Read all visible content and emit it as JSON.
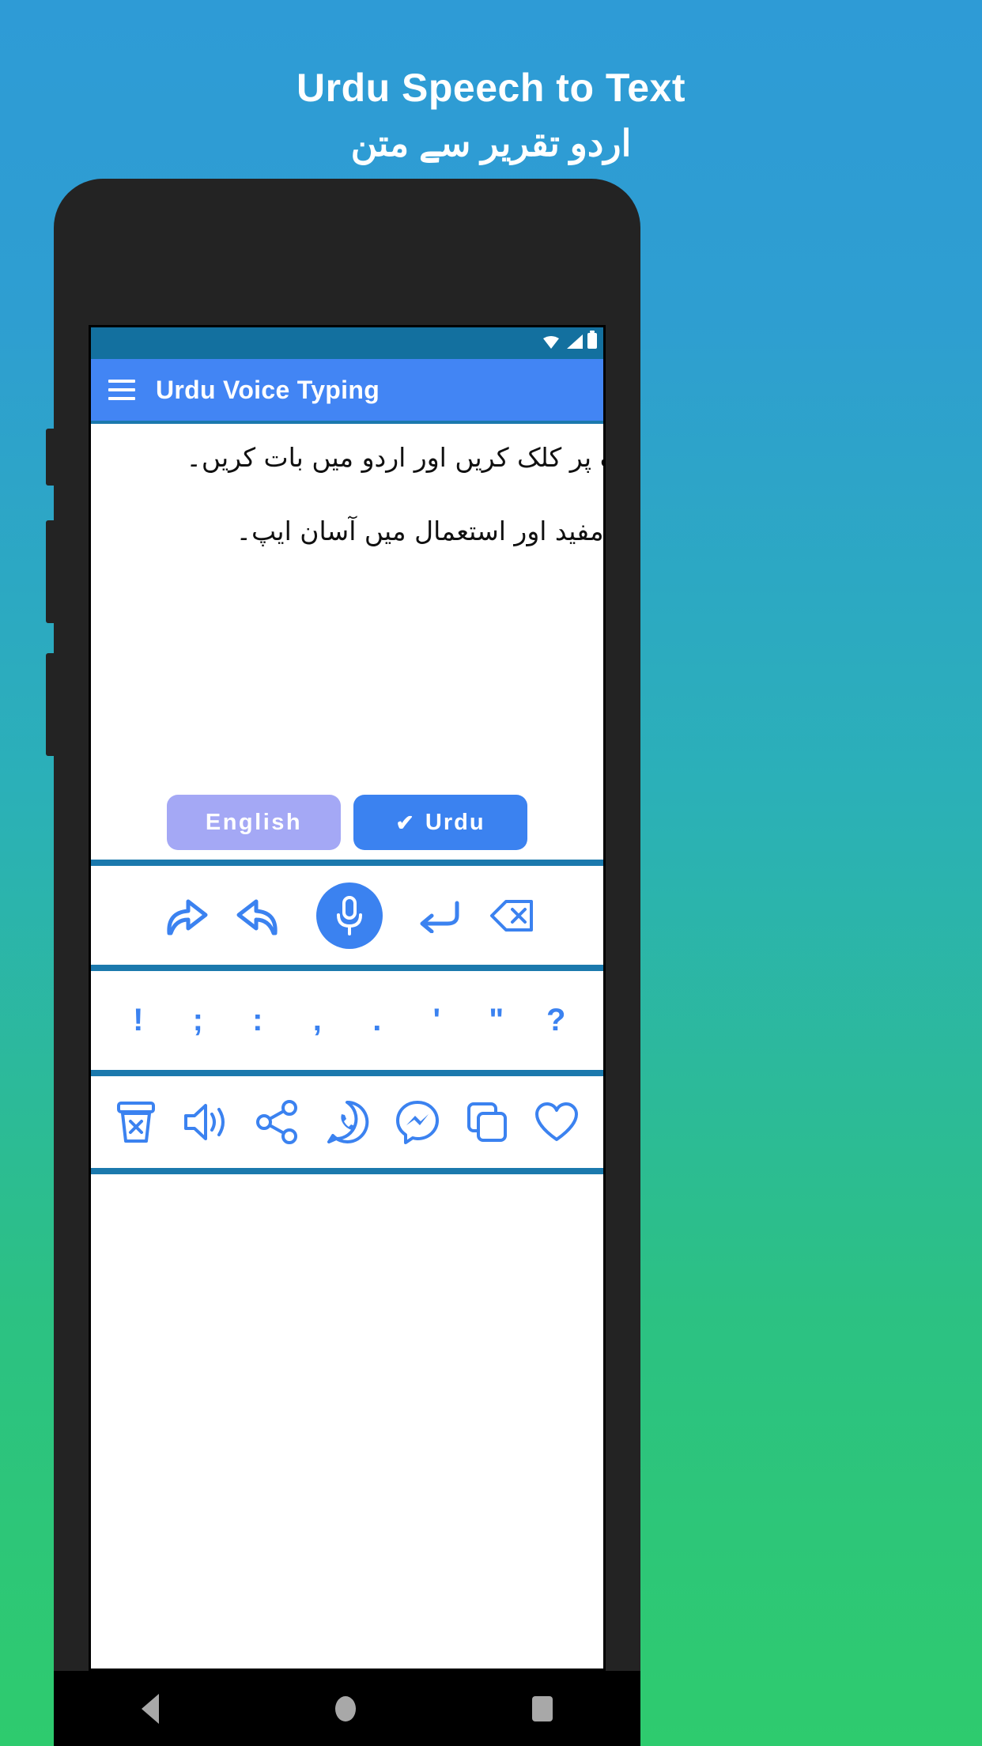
{
  "promo": {
    "title": "Urdu Speech to Text",
    "subtitle": "اردو تقریر سے متن"
  },
  "statusbar": {
    "wifi_icon": "wifi-icon",
    "signal_icon": "signal-icon",
    "battery_icon": "battery-icon"
  },
  "appbar": {
    "menu_icon": "hamburger-menu-icon",
    "title": "Urdu Voice Typing"
  },
  "editor": {
    "line1": "مائیک پر کلک کریں اور اردو میں بات کریں۔",
    "line2": "بہت مفید اور استعمال میں آسان ایپ۔"
  },
  "language": {
    "english_label": "English",
    "urdu_label": "Urdu",
    "urdu_check": "✔",
    "selected": "Urdu",
    "active_color": "#3b82f0",
    "inactive_color": "#a4a8f5"
  },
  "toolbar": {
    "items": [
      {
        "name": "redo-icon",
        "label": "Redo"
      },
      {
        "name": "undo-icon",
        "label": "Undo"
      },
      {
        "name": "microphone-icon",
        "label": "Microphone"
      },
      {
        "name": "enter-icon",
        "label": "New line"
      },
      {
        "name": "backspace-icon",
        "label": "Backspace"
      }
    ]
  },
  "punctuation": {
    "keys": [
      "!",
      ";",
      ":",
      ",",
      ".",
      "'",
      "\"",
      "?"
    ]
  },
  "actions": {
    "items": [
      {
        "name": "delete-icon",
        "label": "Delete"
      },
      {
        "name": "speaker-icon",
        "label": "Speak"
      },
      {
        "name": "share-icon",
        "label": "Share"
      },
      {
        "name": "whatsapp-icon",
        "label": "WhatsApp"
      },
      {
        "name": "messenger-icon",
        "label": "Messenger"
      },
      {
        "name": "copy-icon",
        "label": "Copy"
      },
      {
        "name": "heart-icon",
        "label": "Favorite"
      }
    ]
  },
  "navbar": {
    "back_icon": "back-triangle-icon",
    "home_icon": "home-circle-icon",
    "recents_icon": "recents-square-icon"
  },
  "colors": {
    "background_top": "#2e9bd6",
    "background_bottom": "#2ecb6e",
    "appbar": "#4285f4",
    "statusbar": "#13709f",
    "divider": "#1b79ad",
    "accent": "#3b82f0"
  }
}
